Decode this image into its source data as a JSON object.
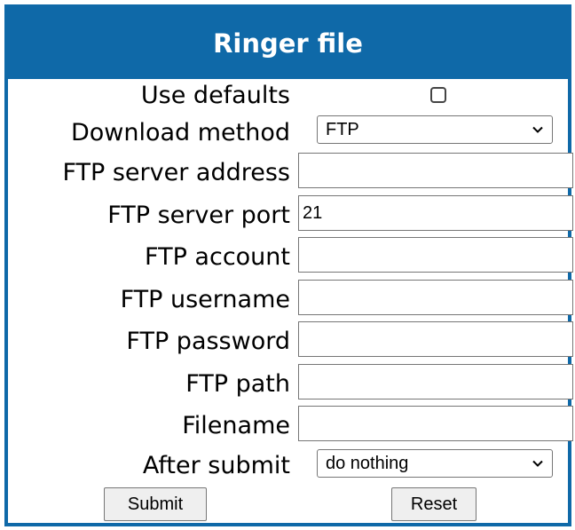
{
  "panel": {
    "title": "Ringer file"
  },
  "form": {
    "use_defaults": {
      "label": "Use defaults",
      "checked": false
    },
    "download_method": {
      "label": "Download method",
      "value": "FTP"
    },
    "ftp_server_address": {
      "label": "FTP server address",
      "value": ""
    },
    "ftp_server_port": {
      "label": "FTP server port",
      "value": "21"
    },
    "ftp_account": {
      "label": "FTP account",
      "value": ""
    },
    "ftp_username": {
      "label": "FTP username",
      "value": ""
    },
    "ftp_password": {
      "label": "FTP password",
      "value": ""
    },
    "ftp_path": {
      "label": "FTP path",
      "value": ""
    },
    "filename": {
      "label": "Filename",
      "value": ""
    },
    "after_submit": {
      "label": "After submit",
      "value": "do nothing"
    }
  },
  "buttons": {
    "submit": "Submit",
    "reset": "Reset"
  },
  "colors": {
    "header_bg": "#0f69a8",
    "header_text": "#ffffff"
  }
}
